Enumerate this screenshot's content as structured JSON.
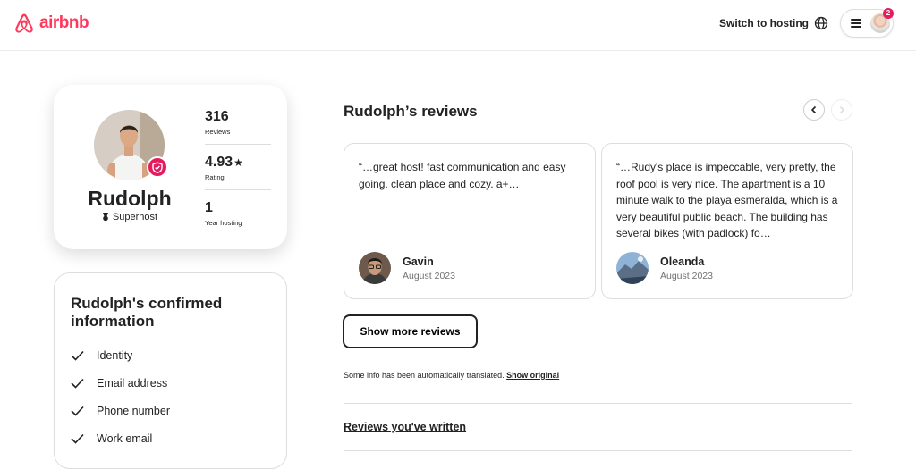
{
  "header": {
    "logo_text": "airbnb",
    "switch_label": "Switch to hosting",
    "notification_count": "2",
    "icons": [
      "airbnb-logo-icon",
      "globe-icon",
      "hamburger-menu-icon",
      "user-avatar"
    ]
  },
  "profile": {
    "name": "Rudolph",
    "superhost_label": "Superhost",
    "stats": [
      {
        "value": "316",
        "label": "Reviews"
      },
      {
        "value": "4.93",
        "label": "Rating"
      },
      {
        "value": "1",
        "label": "Year hosting"
      }
    ]
  },
  "confirmed": {
    "title": "Rudolph's confirmed information",
    "items": [
      "Identity",
      "Email address",
      "Phone number",
      "Work email"
    ]
  },
  "reviews": {
    "title": "Rudolph’s reviews",
    "cards": [
      {
        "text": "“…great host! fast communication and easy going. clean place and cozy. a+…",
        "name": "Gavin",
        "date": "August 2023"
      },
      {
        "text": "“…Rudy's place is impeccable, very pretty, the roof pool is very nice. The apartment is a 10 minute walk to the playa esmeralda, which is a very beautiful public beach. The building has several bikes (with padlock) fo…",
        "name": "Oleanda",
        "date": "August 2023"
      }
    ],
    "show_more_label": "Show more reviews",
    "translated_note": "Some info has been automatically translated.",
    "show_original_label": "Show original",
    "written_label": "Reviews you've written"
  },
  "colors": {
    "brand": "#ff385c",
    "badge": "#e31c5f",
    "text": "#222222",
    "muted": "#717171",
    "border": "#dddddd"
  }
}
